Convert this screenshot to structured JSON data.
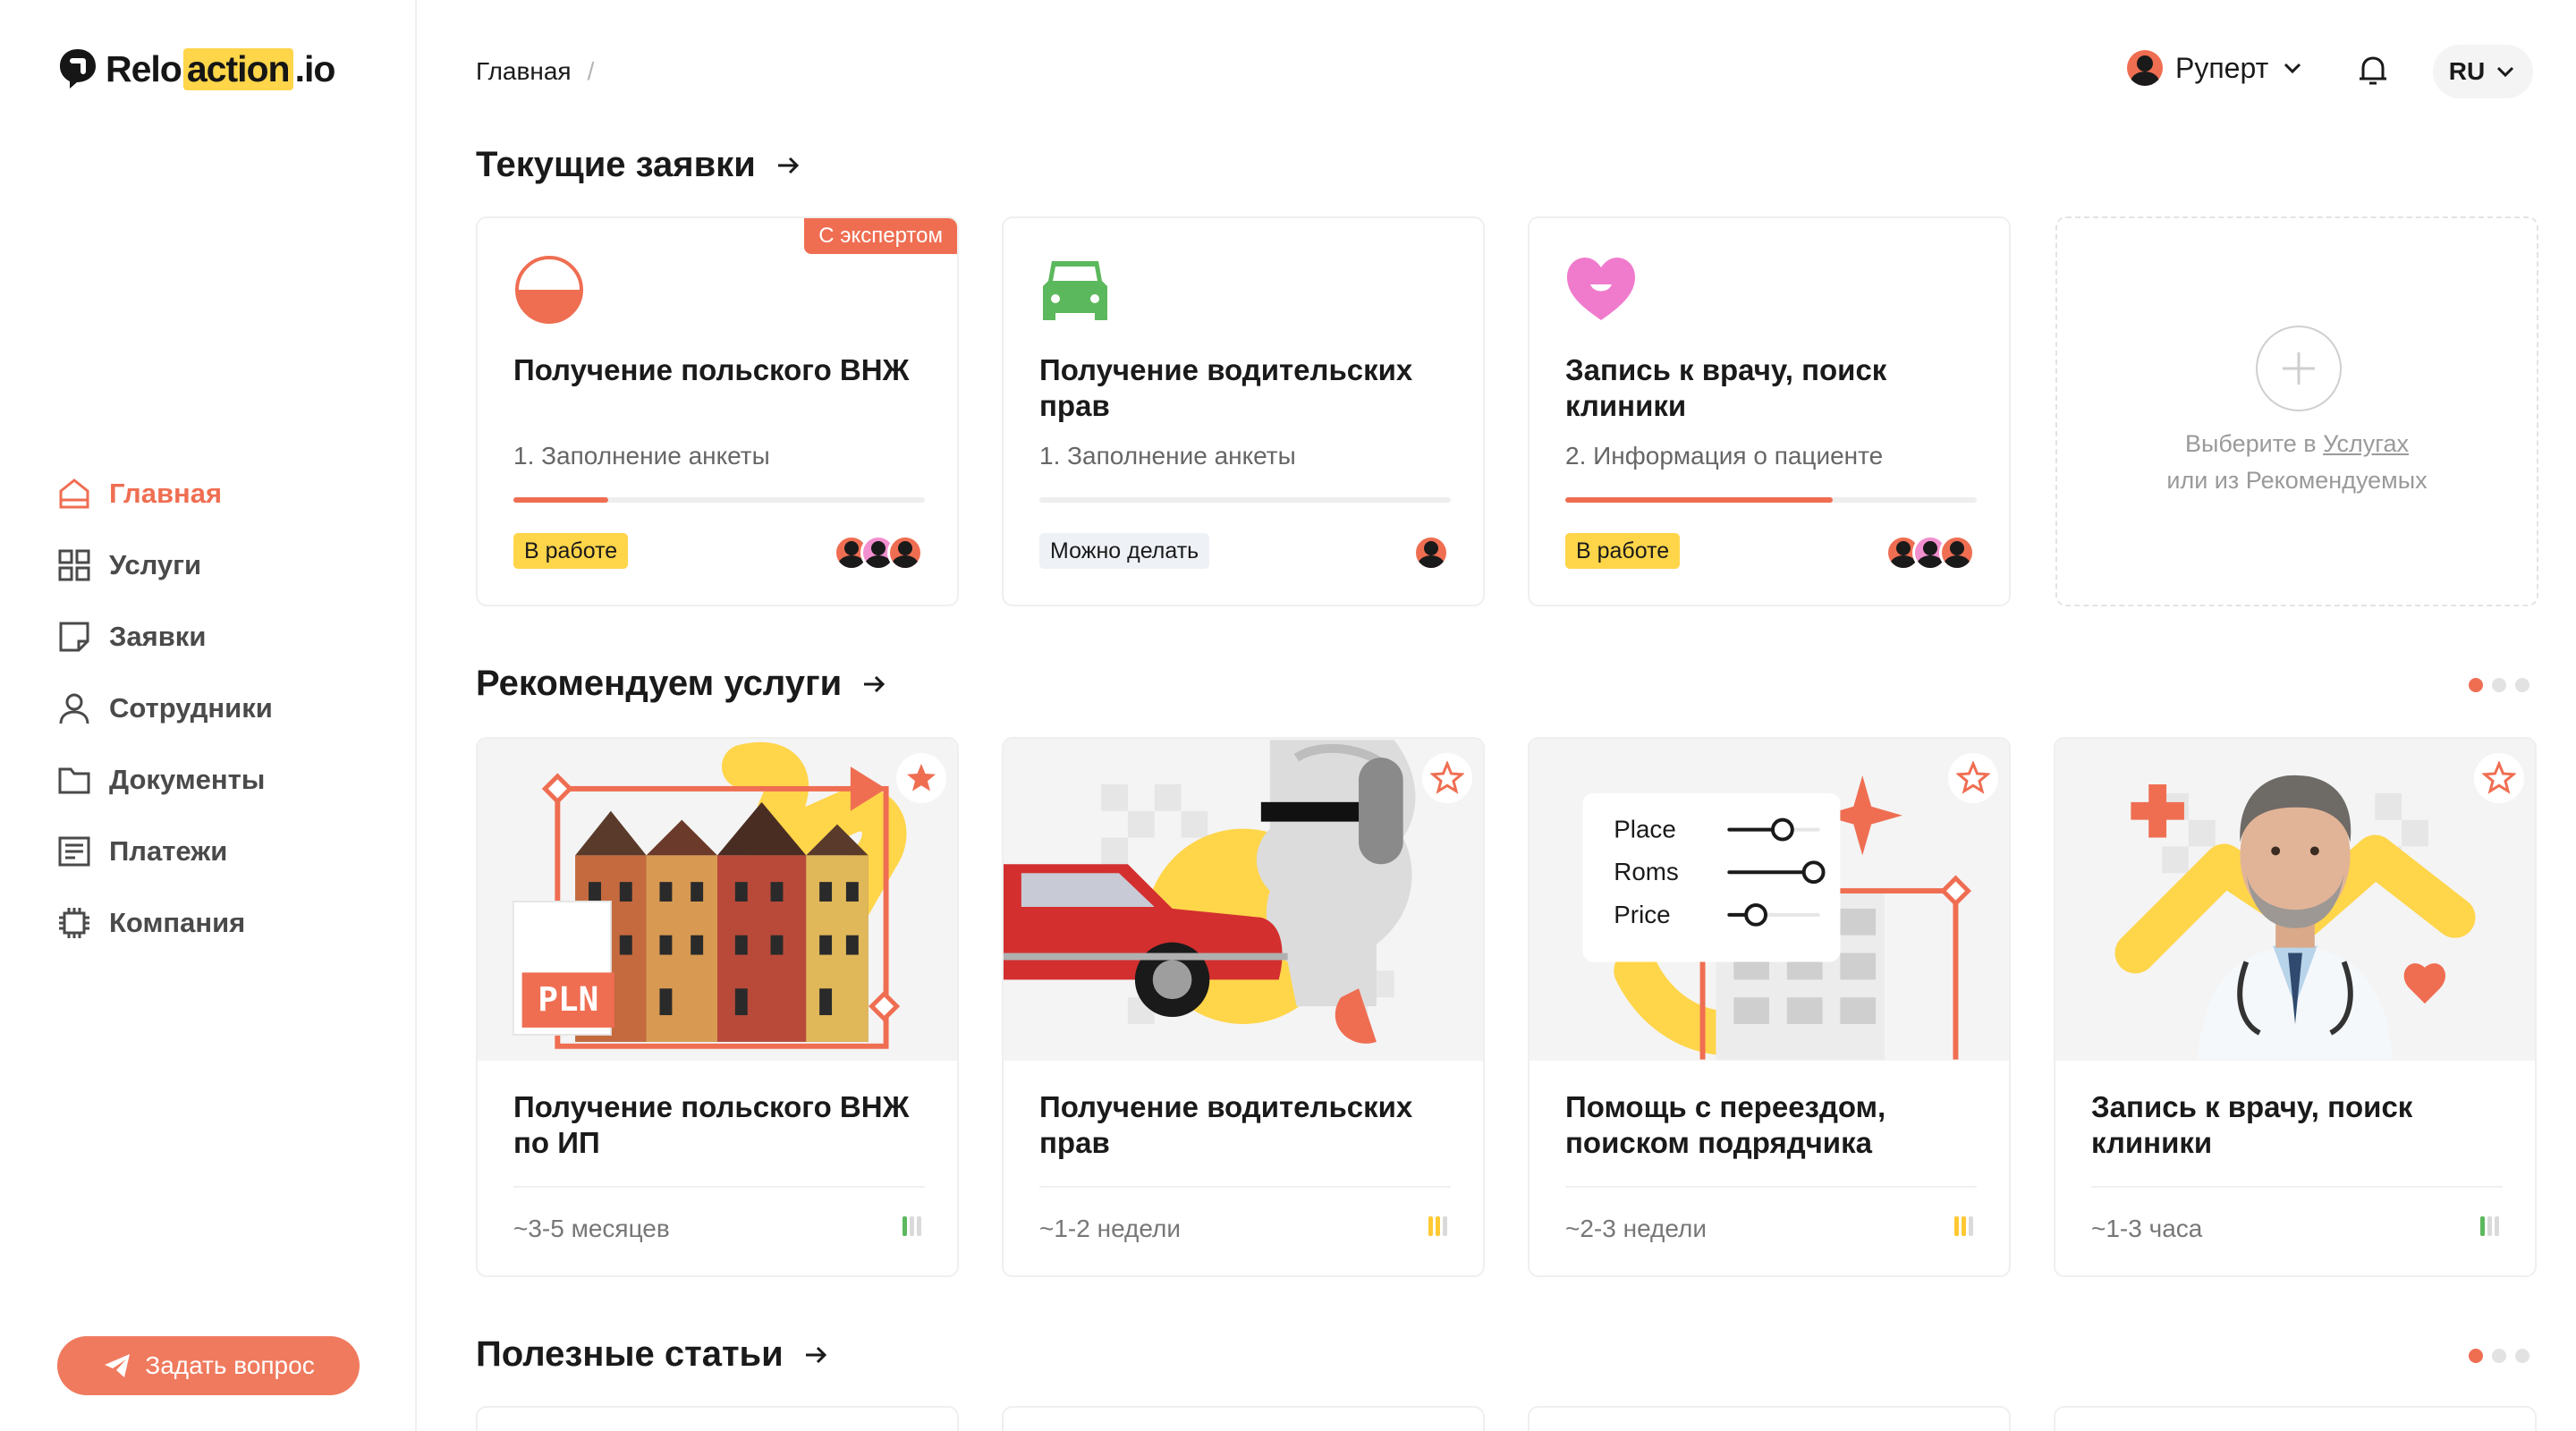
{
  "app": {
    "logo_pre": "Relo",
    "logo_hl": "action",
    "logo_post": ".io",
    "brand_color": "#ef6e52",
    "accent_yellow": "#ffd54a"
  },
  "sidebar": {
    "items": [
      {
        "label": "Главная",
        "icon": "home-icon",
        "active": true
      },
      {
        "label": "Услуги",
        "icon": "grid-icon"
      },
      {
        "label": "Заявки",
        "icon": "note-icon"
      },
      {
        "label": "Сотрудники",
        "icon": "user-icon"
      },
      {
        "label": "Документы",
        "icon": "folder-icon"
      },
      {
        "label": "Платежи",
        "icon": "receipt-icon"
      },
      {
        "label": "Компания",
        "icon": "chip-icon"
      }
    ],
    "ask_button": "Задать вопрос"
  },
  "header": {
    "breadcrumb": "Главная",
    "breadcrumb_sep": "/",
    "user_name": "Руперт",
    "lang": "RU"
  },
  "current": {
    "title": "Текущие заявки",
    "cards": [
      {
        "title": "Получение польского ВНЖ",
        "step": "1. Заполнение анкеты",
        "status": "В работе",
        "badge": "С экспертом",
        "progress": 0.23
      },
      {
        "title": "Получение водительских прав",
        "step": "1. Заполнение анкеты",
        "status": "Можно делать",
        "progress": 0
      },
      {
        "title": "Запись к врачу, поиск клиники",
        "step": "2. Информация о пациенте",
        "status": "В работе",
        "progress": 0.65
      }
    ],
    "add_card": {
      "line1_pre": "Выберите в ",
      "line1_link": "Услугах",
      "line2": "или из Рекомендуемых"
    }
  },
  "recommend": {
    "title": "Рекомендуем услуги",
    "cards": [
      {
        "title": "Получение польского ВНЖ по ИП",
        "duration": "~3-5 месяцев",
        "level_color": "#5cb85c"
      },
      {
        "title": "Получение водительских прав",
        "duration": "~1-2 недели",
        "level_color": "#ffc933"
      },
      {
        "title": "Помощь с переездом, поиском подрядчика",
        "duration": "~2-3 недели",
        "level_color": "#ffc933"
      },
      {
        "title": "Запись к врачу, поиск клиники",
        "duration": "~1-3 часа",
        "level_color": "#5cb85c"
      }
    ],
    "pln_label": "PLN",
    "filters": [
      "Place",
      "Roms",
      "Price"
    ]
  },
  "articles": {
    "title": "Полезные статьи"
  }
}
